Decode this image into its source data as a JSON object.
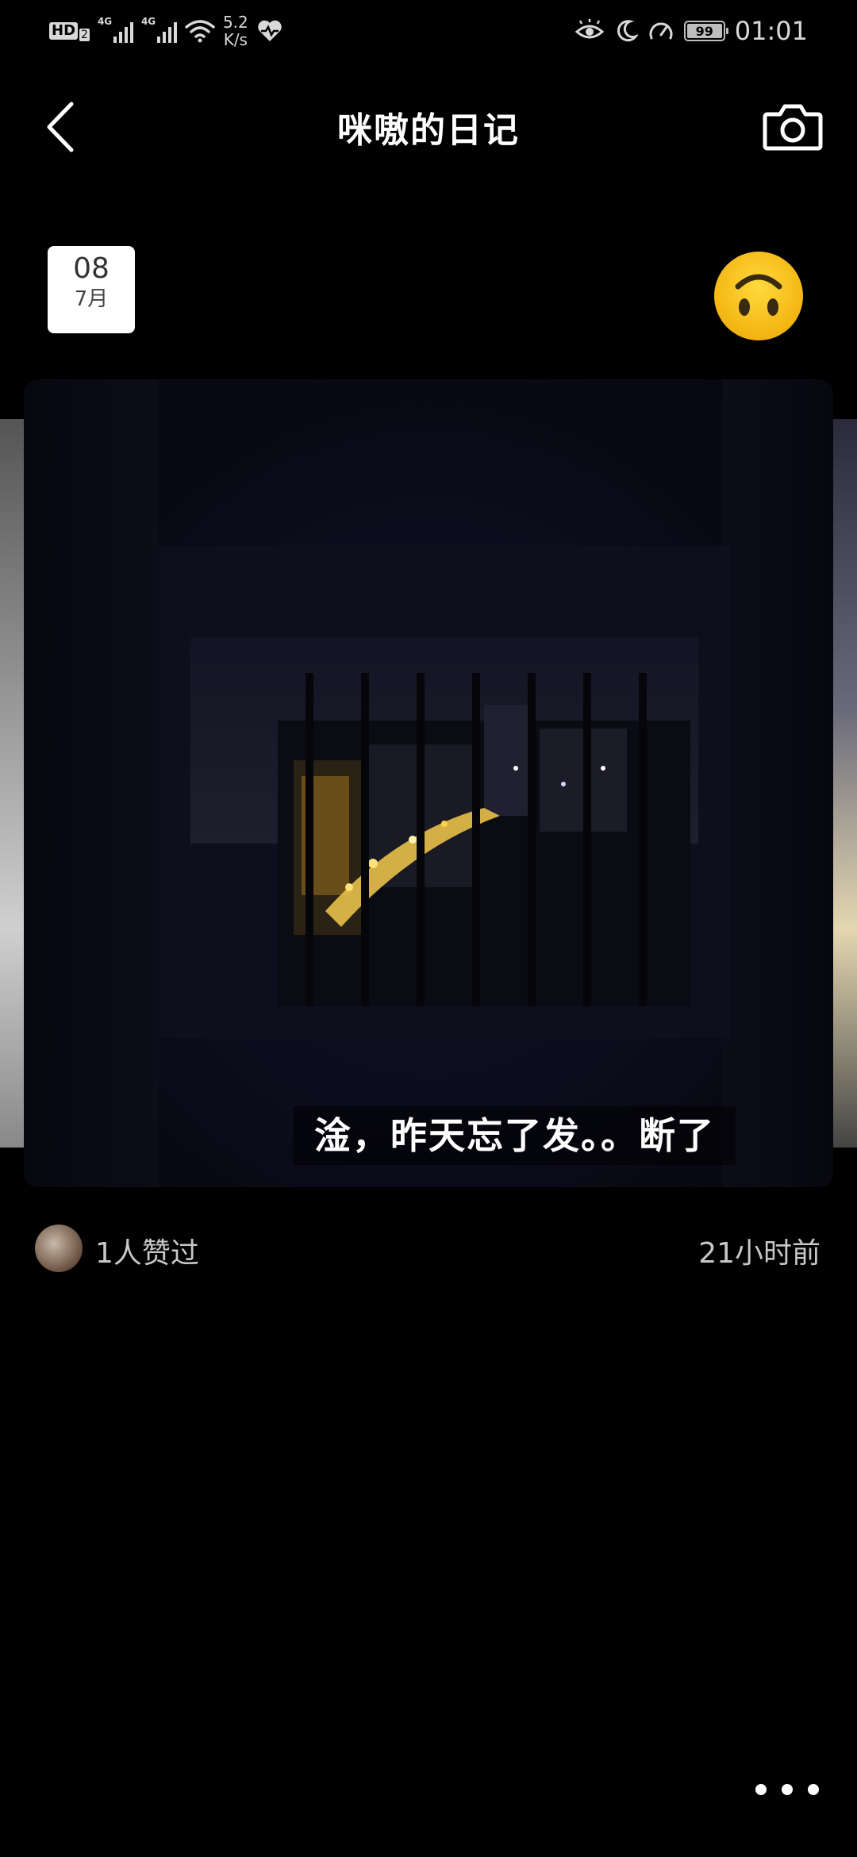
{
  "status_bar": {
    "network_badge": "HD",
    "network_badge_sub": "2",
    "signal1_label": "4G",
    "signal2_label": "4G",
    "speed_value": "5.2",
    "speed_unit": "K/s",
    "battery": "99",
    "time": "01:01"
  },
  "header": {
    "title": "咪嗷的日记",
    "back_icon": "chevron-left-icon",
    "camera_icon": "camera-icon"
  },
  "entry": {
    "date_day": "08",
    "date_month": "7月",
    "mood_icon": "upside-down-face-icon",
    "caption": "淦，昨天忘了发。。断了",
    "likes_text": "1人赞过",
    "time_ago": "21小时前"
  },
  "colors": {
    "background": "#000000",
    "emoji_yellow": "#F9C21A"
  }
}
